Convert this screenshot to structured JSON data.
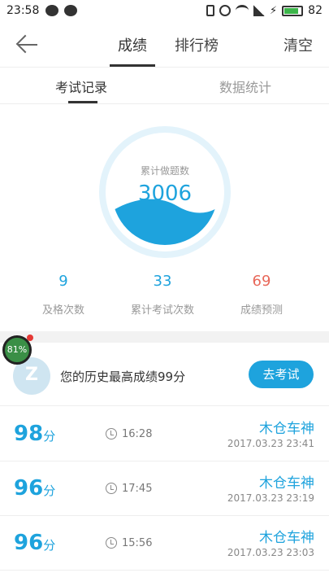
{
  "status_bar": {
    "time": "23:58",
    "battery": "82",
    "battery_level": 0.82,
    "icons": [
      "chat-bubble-icon",
      "wechat-icon",
      "vibrate-icon",
      "alarm-icon",
      "wifi-icon",
      "signal-4g-icon",
      "charging-icon",
      "battery-icon"
    ]
  },
  "header": {
    "tabs": [
      {
        "label": "成绩",
        "active": true
      },
      {
        "label": "排行榜",
        "active": false
      }
    ],
    "clear_label": "清空",
    "back_icon": "arrow-left-icon"
  },
  "subtabs": [
    {
      "label": "考试记录",
      "active": true
    },
    {
      "label": "数据统计",
      "active": false
    }
  ],
  "gauge": {
    "label": "累计做题数",
    "value": "3006"
  },
  "stats": [
    {
      "value": "9",
      "label": "及格次数",
      "color": "#1ea3dd"
    },
    {
      "value": "33",
      "label": "累计考试次数",
      "color": "#1ea3dd"
    },
    {
      "value": "69",
      "label": "成绩预测",
      "color": "#e8685a"
    }
  ],
  "floating_badge": "81%",
  "best": {
    "text": "您的历史最高成绩99分",
    "button": "去考试"
  },
  "records": [
    {
      "score": "98",
      "unit": "分",
      "duration": "16:28",
      "name": "木仓车神",
      "date": "2017.03.23  23:41"
    },
    {
      "score": "96",
      "unit": "分",
      "duration": "17:45",
      "name": "木仓车神",
      "date": "2017.03.23  23:19"
    },
    {
      "score": "96",
      "unit": "分",
      "duration": "15:56",
      "name": "木仓车神",
      "date": "2017.03.23  23:03"
    }
  ],
  "colors": {
    "accent": "#1ea3dd",
    "predict": "#e8685a"
  }
}
